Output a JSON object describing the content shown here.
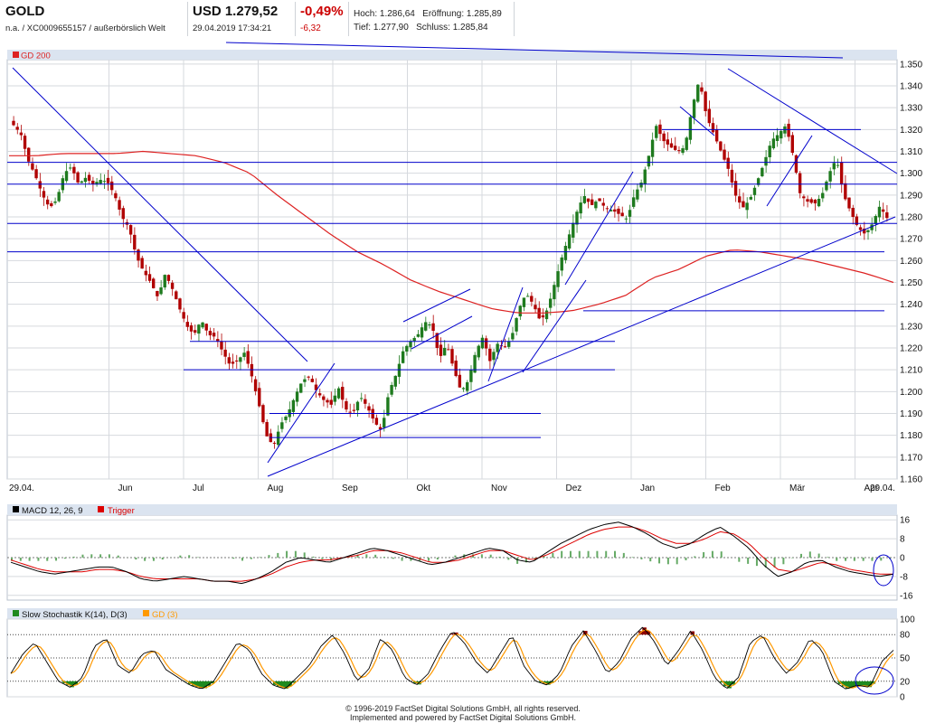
{
  "header": {
    "symbol": "GOLD",
    "isin_line": "n.a. / XC0009655157 / außerbörslich Welt",
    "price": "USD 1.279,52",
    "datetime": "29.04.2019 17:34:21",
    "change_pct": "-0,49%",
    "change_abs": "-6,32",
    "high": "Hoch: 1.286,64",
    "open": "Eröffnung: 1.285,89",
    "low": "Tief: 1.277,90",
    "close": "Schluss: 1.285,84"
  },
  "colors": {
    "bull": "#1e7a1e",
    "bear": "#b00000",
    "trendline": "#0000cc",
    "gd200": "#dd2222",
    "macd": "#000000",
    "trigger": "#dd0000",
    "histogram": "#66aa66",
    "stoch_k": "#000000",
    "stoch_d": "#ff9900",
    "overbought_fill": "#8b0000",
    "oversold_fill": "#1f8a1f",
    "grid": "#d6d9de",
    "panel_legend_bg": "#dbe4f0"
  },
  "chart_data": [
    {
      "type": "candlestick",
      "title": "GOLD",
      "legend": [
        "GD 200"
      ],
      "y_axis_ticks": [
        "1.160",
        "1.170",
        "1.180",
        "1.190",
        "1.200",
        "1.210",
        "1.220",
        "1.230",
        "1.240",
        "1.250",
        "1.260",
        "1.270",
        "1.280",
        "1.290",
        "1.300",
        "1.310",
        "1.320",
        "1.330",
        "1.340",
        "1.350"
      ],
      "ylim": [
        1160,
        1352
      ],
      "x_axis_labels": [
        "29.04.",
        "Jun",
        "Jul",
        "Aug",
        "Sep",
        "Okt",
        "Nov",
        "Dez",
        "Jan",
        "Feb",
        "Mär",
        "Apr",
        "29.04."
      ],
      "close_path_approx": [
        1322,
        1318,
        1306,
        1299,
        1290,
        1284,
        1288,
        1300,
        1303,
        1295,
        1298,
        1295,
        1297,
        1296,
        1290,
        1280,
        1275,
        1262,
        1255,
        1250,
        1243,
        1254,
        1247,
        1238,
        1230,
        1226,
        1233,
        1226,
        1225,
        1218,
        1212,
        1214,
        1218,
        1207,
        1194,
        1180,
        1175,
        1185,
        1190,
        1198,
        1205,
        1207,
        1200,
        1196,
        1194,
        1202,
        1192,
        1190,
        1198,
        1193,
        1186,
        1182,
        1200,
        1208,
        1219,
        1223,
        1226,
        1232,
        1230,
        1215,
        1222,
        1210,
        1200,
        1205,
        1218,
        1225,
        1214,
        1222,
        1220,
        1225,
        1238,
        1245,
        1240,
        1232,
        1238,
        1250,
        1262,
        1272,
        1282,
        1290,
        1285,
        1288,
        1284,
        1283,
        1281,
        1279,
        1290,
        1296,
        1308,
        1322,
        1315,
        1312,
        1310,
        1312,
        1330,
        1343,
        1326,
        1318,
        1310,
        1302,
        1290,
        1284,
        1288,
        1296,
        1305,
        1315,
        1318,
        1322,
        1308,
        1290,
        1287,
        1286,
        1290,
        1300,
        1307,
        1290,
        1282,
        1275,
        1272,
        1277,
        1285,
        1279.5
      ],
      "gd200_path_approx": [
        1308,
        1308,
        1309,
        1309,
        1309,
        1310,
        1309,
        1308,
        1305,
        1300,
        1290,
        1281,
        1272,
        1264,
        1258,
        1251,
        1246,
        1242,
        1238,
        1236,
        1236,
        1237,
        1240,
        1244,
        1252,
        1256,
        1262,
        1265,
        1264,
        1262,
        1260,
        1257,
        1254,
        1250
      ],
      "horizontal_lines": [
        1295,
        1305,
        1237,
        1223,
        1210,
        1190,
        1179,
        1320,
        1277,
        1264
      ],
      "trend_lines": "sloped support from 1.160 (Aug) to 1.275 (Apr); resistance from Feb high 1.347 down to 1.296 (Apr)"
    },
    {
      "type": "line",
      "title": "MACD 12, 26, 9",
      "legend": [
        "MACD 12, 26, 9",
        "Trigger"
      ],
      "y_axis_ticks": [
        "16",
        "8",
        "0",
        "-8",
        "-16"
      ],
      "ylim": [
        -18,
        18
      ],
      "macd_path_approx": [
        -2,
        -4,
        -6,
        -7,
        -6,
        -5,
        -4,
        -4,
        -6,
        -9,
        -10,
        -9,
        -8,
        -9,
        -10,
        -10,
        -11,
        -9,
        -6,
        -2,
        0,
        -1,
        -2,
        0,
        2,
        4,
        3,
        1,
        -1,
        -3,
        -2,
        0,
        2,
        4,
        3,
        -1,
        -2,
        2,
        6,
        9,
        12,
        14,
        15,
        13,
        10,
        6,
        4,
        6,
        10,
        13,
        9,
        4,
        -3,
        -8,
        -6,
        -2,
        -1,
        -4,
        -6,
        -7,
        -8,
        -7
      ],
      "trigger_path_approx": [
        -1,
        -3,
        -5,
        -6,
        -6,
        -6,
        -5,
        -5,
        -6,
        -8,
        -9,
        -9,
        -9,
        -9,
        -10,
        -10,
        -10,
        -9,
        -7,
        -4,
        -2,
        -1,
        -1,
        0,
        1,
        3,
        3,
        2,
        0,
        -2,
        -2,
        -1,
        1,
        3,
        3,
        1,
        -1,
        1,
        4,
        7,
        10,
        12,
        13,
        13,
        11,
        8,
        6,
        6,
        8,
        11,
        10,
        6,
        0,
        -5,
        -6,
        -4,
        -2,
        -3,
        -5,
        -6,
        -7,
        -7
      ]
    },
    {
      "type": "line",
      "title": "Slow Stochastik K(14), D(3)",
      "legend": [
        "Slow Stochastik K(14), D(3)",
        "GD (3)"
      ],
      "y_axis_ticks": [
        "100",
        "80",
        "50",
        "20",
        "0"
      ],
      "ylim": [
        0,
        100
      ],
      "k_path_approx": [
        30,
        55,
        70,
        45,
        20,
        12,
        25,
        65,
        75,
        40,
        30,
        55,
        60,
        35,
        25,
        15,
        10,
        20,
        45,
        70,
        60,
        30,
        15,
        10,
        25,
        40,
        65,
        80,
        55,
        20,
        35,
        75,
        60,
        25,
        15,
        30,
        60,
        85,
        70,
        45,
        30,
        55,
        80,
        40,
        20,
        15,
        30,
        65,
        85,
        60,
        30,
        45,
        75,
        90,
        70,
        40,
        60,
        85,
        60,
        25,
        10,
        25,
        70,
        80,
        50,
        30,
        45,
        75,
        60,
        20,
        10,
        15,
        12,
        45,
        60
      ]
    }
  ],
  "footer": {
    "line1": "© 1996-2019 FactSet Digital Solutions GmbH, all rights reserved.",
    "line2": "Implemented and powered by FactSet Digital Solutions GmbH."
  }
}
